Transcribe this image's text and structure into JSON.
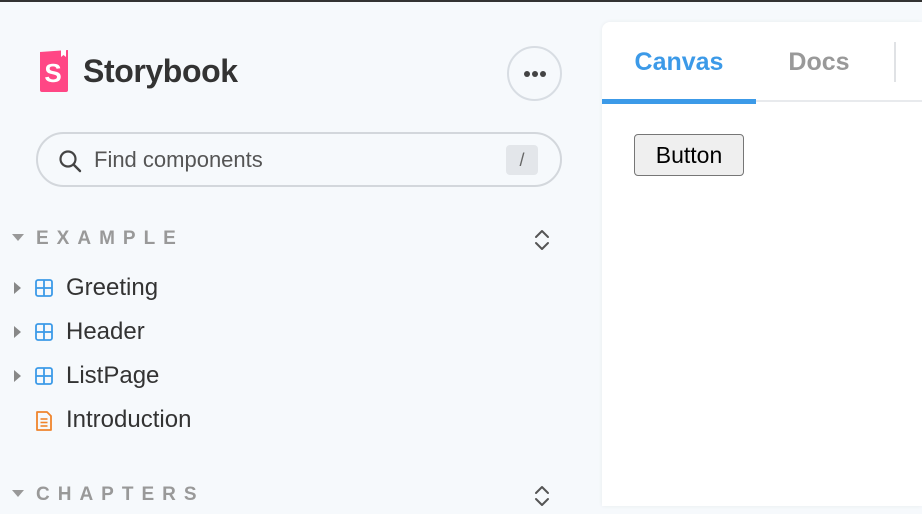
{
  "brand": {
    "name": "Storybook",
    "logo_icon": "storybook-logo-icon",
    "color": "#ff4785"
  },
  "menu": {
    "icon": "ellipsis-icon"
  },
  "search": {
    "placeholder": "Find components",
    "shortcut": "/"
  },
  "sections": [
    {
      "title": "EXAMPLE",
      "items": [
        {
          "label": "Greeting",
          "icon": "component-icon",
          "expandable": true
        },
        {
          "label": "Header",
          "icon": "component-icon",
          "expandable": true
        },
        {
          "label": "ListPage",
          "icon": "component-icon",
          "expandable": true
        },
        {
          "label": "Introduction",
          "icon": "document-icon",
          "expandable": false
        }
      ]
    },
    {
      "title": "CHAPTERS",
      "items": []
    }
  ],
  "tabs": [
    {
      "label": "Canvas",
      "active": true
    },
    {
      "label": "Docs",
      "active": false
    }
  ],
  "preview": {
    "button_label": "Button"
  },
  "colors": {
    "accent": "#3c9ae8",
    "component": "#3c9ae8",
    "document": "#f0842c",
    "muted": "#999999"
  }
}
